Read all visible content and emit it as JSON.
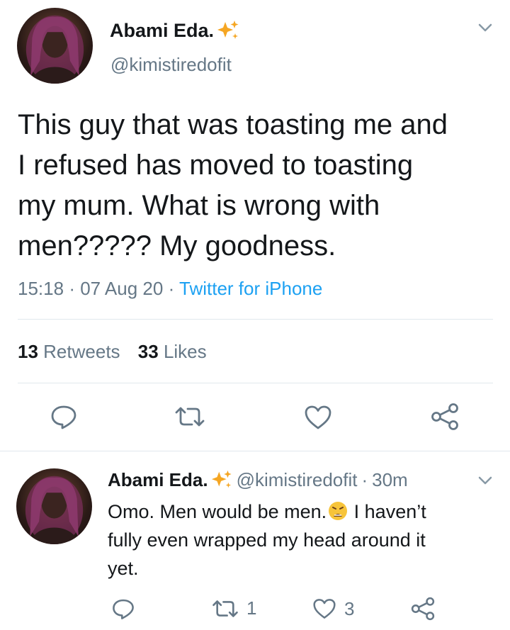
{
  "main_tweet": {
    "display_name": "Abami Eda.",
    "handle": "@kimistiredofit",
    "text_lines": [
      "This guy that was toasting me and",
      "I refused has moved to toasting",
      "my mum. What is wrong with",
      "men????? My goodness."
    ],
    "time": "15:18",
    "date": "07 Aug 20",
    "separator": "·",
    "source": "Twitter for iPhone",
    "retweets_count": "13",
    "retweets_label": "Retweets",
    "likes_count": "33",
    "likes_label": "Likes"
  },
  "reply_tweet": {
    "display_name": "Abami Eda.",
    "handle": "@kimistiredofit",
    "separator": "·",
    "time_ago": "30m",
    "text_part1": "Omo. Men would be men.",
    "emoji": "😫",
    "text_part2": " I haven’t",
    "text_line2": "fully even wrapped my head around it",
    "text_line3": "yet.",
    "retweet_count": "1",
    "like_count": "3"
  },
  "colors": {
    "accent": "#1da1f2",
    "muted": "#657786",
    "divider": "#e1e8ed",
    "sparkle": "#f5a623"
  },
  "icons": [
    "chevron-down-icon",
    "sparkle-icon",
    "reply-icon",
    "retweet-icon",
    "heart-icon",
    "share-icon",
    "emoji-icon"
  ]
}
